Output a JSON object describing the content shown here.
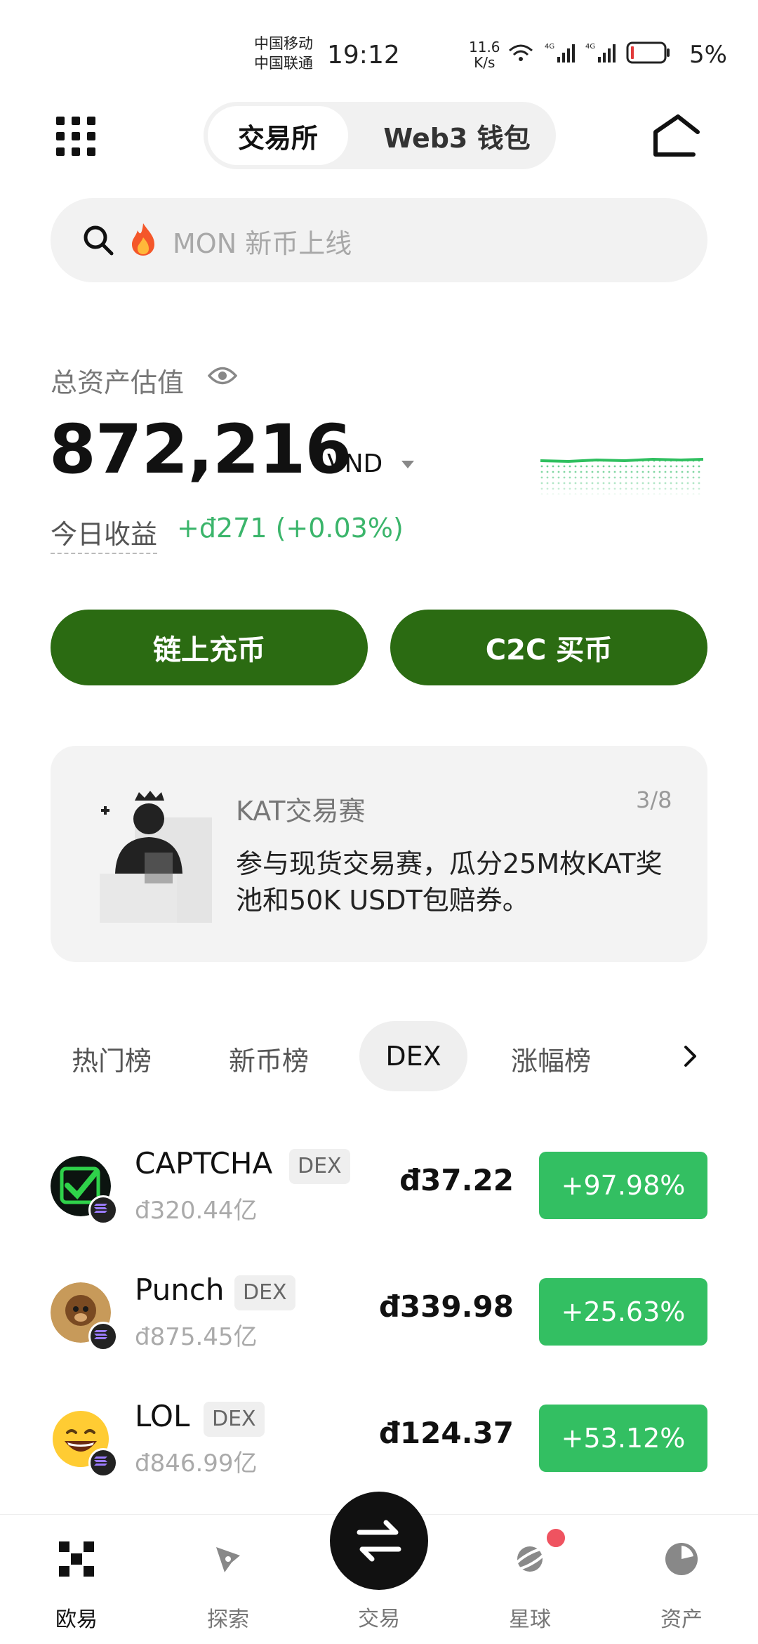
{
  "status_bar": {
    "carrier1": "中国移动",
    "carrier2": "中国联通",
    "time": "19:12",
    "speed_value": "11.6",
    "speed_unit": "K/s",
    "battery_pct": "5%"
  },
  "header": {
    "tab_exchange": "交易所",
    "tab_wallet": "Web3 钱包"
  },
  "search": {
    "placeholder": "MON 新币上线"
  },
  "balance": {
    "label": "总资产估值",
    "value": "872,216",
    "currency": "VND",
    "pnl_label": "今日收益",
    "pnl_value": "+đ271 (+0.03%)",
    "pnl_color": "#3bb56b"
  },
  "actions": {
    "deposit": "链上充币",
    "c2c": "C2C 买币",
    "button_color": "#2b6b12"
  },
  "promo": {
    "title": "KAT交易赛",
    "page": "3/8",
    "body": "参与现货交易赛，瓜分25M枚KAT奖池和50K USDT包赔券。"
  },
  "tabs": {
    "hot": "热门榜",
    "new": "新币榜",
    "dex": "DEX",
    "gainers": "涨幅榜"
  },
  "rows": [
    {
      "name": "CAPTCHA",
      "badge": "DEX",
      "cap": "đ320.44亿",
      "price": "đ37.22",
      "change": "+97.98%"
    },
    {
      "name": "Punch",
      "badge": "DEX",
      "cap": "đ875.45亿",
      "price": "đ339.98",
      "change": "+25.63%"
    },
    {
      "name": "LOL",
      "badge": "DEX",
      "cap": "đ846.99亿",
      "price": "đ124.37",
      "change": "+53.12%"
    }
  ],
  "nav": {
    "home": "欧易",
    "explore": "探索",
    "trade": "交易",
    "planet": "星球",
    "assets": "资产"
  },
  "colors": {
    "up_green": "#33bf62"
  }
}
